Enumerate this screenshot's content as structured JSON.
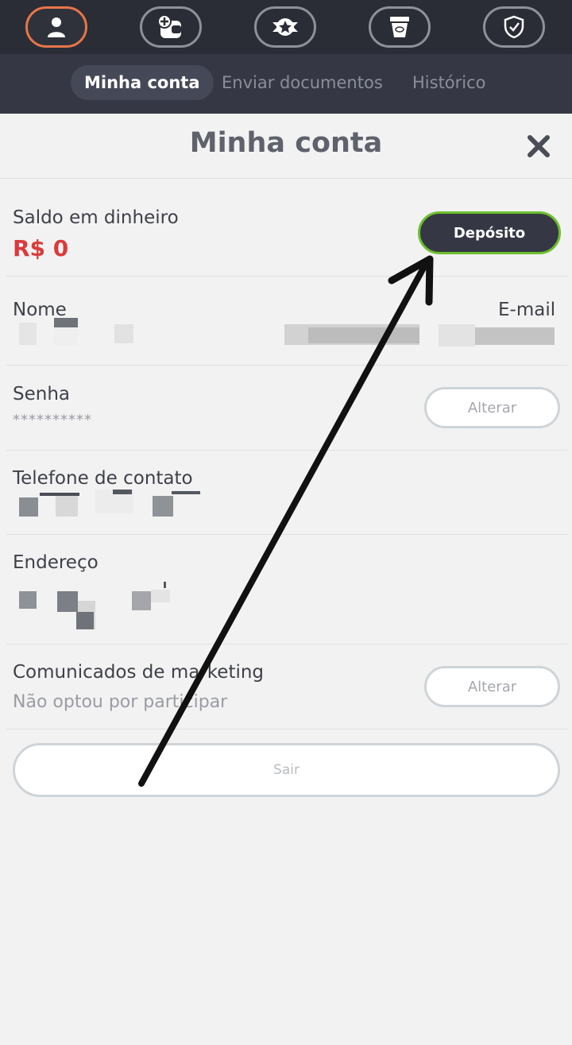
{
  "nav_icons": [
    {
      "name": "user-icon",
      "active": true
    },
    {
      "name": "wallet-plus-icon",
      "active": false
    },
    {
      "name": "star-badge-icon",
      "active": false
    },
    {
      "name": "coffee-cup-icon",
      "active": false
    },
    {
      "name": "shield-check-icon",
      "active": false
    }
  ],
  "subtabs": [
    "Minha conta",
    "Enviar documentos",
    "Histórico"
  ],
  "page": {
    "title": "Minha conta"
  },
  "balance": {
    "label": "Saldo em dinheiro",
    "value": "R$ 0",
    "deposit_label": "Depósito"
  },
  "contact": {
    "name_label": "Nome",
    "email_label": "E-mail"
  },
  "password": {
    "label": "Senha",
    "value": "**********",
    "change_label": "Alterar"
  },
  "phone": {
    "label": "Telefone de contato"
  },
  "address": {
    "label": "Endereço"
  },
  "marketing": {
    "label": "Comunicados de marketing",
    "value": "Não optou por participar",
    "change_label": "Alterar"
  },
  "logout_label": "Sair",
  "colors": {
    "accent_orange": "#e8754a",
    "deposit_green": "#6cbf2d",
    "balance_red": "#d93b3b",
    "nav_dark": "#2a2d35"
  }
}
